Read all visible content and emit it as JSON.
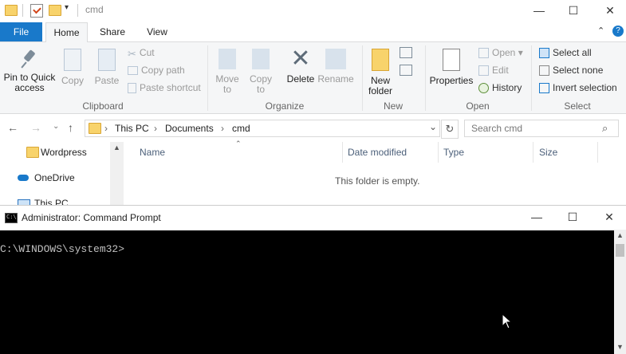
{
  "explorer": {
    "window_title": "cmd",
    "tabs": [
      "File",
      "Home",
      "Share",
      "View"
    ],
    "ribbon": {
      "clipboard": {
        "pin": "Pin to Quick access",
        "copy": "Copy",
        "paste": "Paste",
        "cut": "Cut",
        "copy_path": "Copy path",
        "paste_shortcut": "Paste shortcut",
        "label": "Clipboard"
      },
      "organize": {
        "move_to": "Move to",
        "copy_to": "Copy to",
        "delete": "Delete",
        "rename": "Rename",
        "label": "Organize"
      },
      "new": {
        "new_folder": "New folder",
        "label": "New"
      },
      "open": {
        "properties": "Properties",
        "open": "Open",
        "edit": "Edit",
        "history": "History",
        "label": "Open"
      },
      "select": {
        "select_all": "Select all",
        "select_none": "Select none",
        "invert": "Invert selection",
        "label": "Select"
      }
    },
    "breadcrumb": [
      "This PC",
      "Documents",
      "cmd"
    ],
    "search_placeholder": "Search cmd",
    "nav_items": [
      "Wordpress",
      "OneDrive",
      "This PC"
    ],
    "columns": [
      "Name",
      "Date modified",
      "Type",
      "Size"
    ],
    "empty_message": "This folder is empty."
  },
  "cmd": {
    "title": "Administrator: Command Prompt",
    "prompt": "C:\\WINDOWS\\system32>"
  },
  "colors": {
    "file_tab": "#1979ca",
    "ribbon_bg": "#f5f6f7",
    "console_bg": "#000000",
    "console_text": "#c0c0c0",
    "folder": "#f8d36b"
  }
}
